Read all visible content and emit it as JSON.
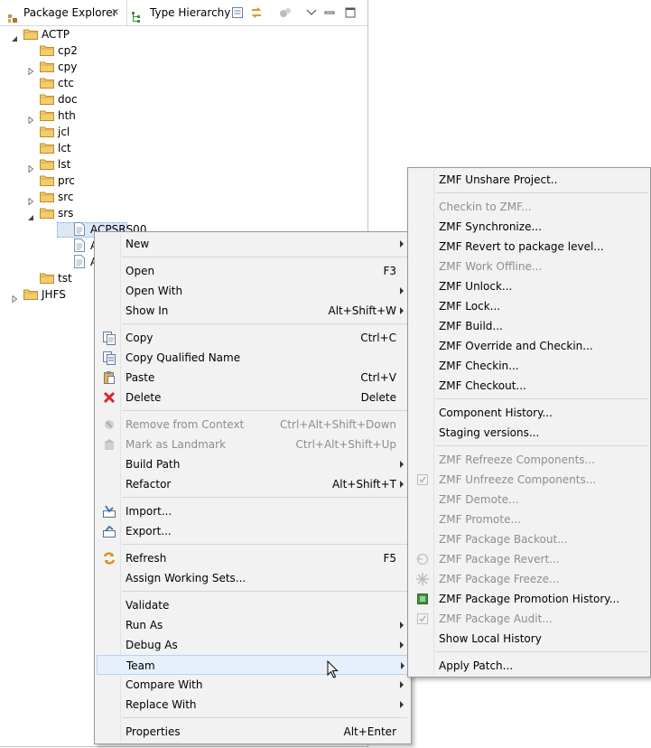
{
  "view": {
    "tabs": [
      {
        "label": "Package Explorer",
        "icon": "package-icon"
      },
      {
        "label": "Type Hierarchy",
        "icon": "hierarchy-icon"
      }
    ],
    "close_glyph": "✕"
  },
  "tree": {
    "nodes": [
      {
        "label": "ACTP",
        "icon": "folder-icon",
        "state": "open"
      },
      {
        "label": "cp2",
        "icon": "folder-icon",
        "state": "leaf"
      },
      {
        "label": "cpy",
        "icon": "folder-icon",
        "state": "closed"
      },
      {
        "label": "ctc",
        "icon": "folder-icon",
        "state": "leaf"
      },
      {
        "label": "doc",
        "icon": "folder-icon",
        "state": "leaf"
      },
      {
        "label": "hth",
        "icon": "folder-icon",
        "state": "closed"
      },
      {
        "label": "jcl",
        "icon": "folder-icon",
        "state": "leaf"
      },
      {
        "label": "lct",
        "icon": "folder-icon",
        "state": "leaf"
      },
      {
        "label": "lst",
        "icon": "folder-icon",
        "state": "closed"
      },
      {
        "label": "prc",
        "icon": "folder-icon",
        "state": "leaf"
      },
      {
        "label": "src",
        "icon": "folder-icon",
        "state": "closed"
      },
      {
        "label": "srs",
        "icon": "folder-icon",
        "state": "open"
      },
      {
        "label": "ACPSRS00",
        "icon": "file-icon",
        "state": "leaf"
      },
      {
        "label": "ACI",
        "icon": "file-icon",
        "state": "leaf"
      },
      {
        "label": "ACI",
        "icon": "file-icon",
        "state": "leaf"
      },
      {
        "label": "tst",
        "icon": "folder-icon",
        "state": "leaf"
      },
      {
        "label": "JHFS",
        "icon": "folder-icon",
        "state": "closed"
      }
    ]
  },
  "context_menu": {
    "items": [
      {
        "label": "New",
        "shortcut": "",
        "submenu": true,
        "enabled": true,
        "icon": ""
      },
      {
        "sep": true
      },
      {
        "label": "Open",
        "shortcut": "F3",
        "submenu": false,
        "enabled": true,
        "icon": ""
      },
      {
        "label": "Open With",
        "shortcut": "",
        "submenu": true,
        "enabled": true,
        "icon": ""
      },
      {
        "label": "Show In",
        "shortcut": "Alt+Shift+W",
        "submenu": true,
        "enabled": true,
        "icon": ""
      },
      {
        "sep": true
      },
      {
        "label": "Copy",
        "shortcut": "Ctrl+C",
        "submenu": false,
        "enabled": true,
        "icon": "copy-icon"
      },
      {
        "label": "Copy Qualified Name",
        "shortcut": "",
        "submenu": false,
        "enabled": true,
        "icon": "copy-qualified-icon"
      },
      {
        "label": "Paste",
        "shortcut": "Ctrl+V",
        "submenu": false,
        "enabled": true,
        "icon": "paste-icon"
      },
      {
        "label": "Delete",
        "shortcut": "Delete",
        "submenu": false,
        "enabled": true,
        "icon": "delete-icon"
      },
      {
        "sep": true
      },
      {
        "label": "Remove from Context",
        "shortcut": "Ctrl+Alt+Shift+Down",
        "submenu": false,
        "enabled": false,
        "icon": "remove-context-icon"
      },
      {
        "label": "Mark as Landmark",
        "shortcut": "Ctrl+Alt+Shift+Up",
        "submenu": false,
        "enabled": false,
        "icon": "landmark-icon"
      },
      {
        "label": "Build Path",
        "shortcut": "",
        "submenu": true,
        "enabled": true,
        "icon": ""
      },
      {
        "label": "Refactor",
        "shortcut": "Alt+Shift+T",
        "submenu": true,
        "enabled": true,
        "icon": ""
      },
      {
        "sep": true
      },
      {
        "label": "Import...",
        "shortcut": "",
        "submenu": false,
        "enabled": true,
        "icon": "import-icon"
      },
      {
        "label": "Export...",
        "shortcut": "",
        "submenu": false,
        "enabled": true,
        "icon": "export-icon"
      },
      {
        "sep": true
      },
      {
        "label": "Refresh",
        "shortcut": "F5",
        "submenu": false,
        "enabled": true,
        "icon": "refresh-icon"
      },
      {
        "label": "Assign Working Sets...",
        "shortcut": "",
        "submenu": false,
        "enabled": true,
        "icon": ""
      },
      {
        "sep": true
      },
      {
        "label": "Validate",
        "shortcut": "",
        "submenu": false,
        "enabled": true,
        "icon": ""
      },
      {
        "label": "Run As",
        "shortcut": "",
        "submenu": true,
        "enabled": true,
        "icon": ""
      },
      {
        "label": "Debug As",
        "shortcut": "",
        "submenu": true,
        "enabled": true,
        "icon": ""
      },
      {
        "label": "Team",
        "shortcut": "",
        "submenu": true,
        "enabled": true,
        "icon": "",
        "highlighted": true
      },
      {
        "label": "Compare With",
        "shortcut": "",
        "submenu": true,
        "enabled": true,
        "icon": ""
      },
      {
        "label": "Replace With",
        "shortcut": "",
        "submenu": true,
        "enabled": true,
        "icon": ""
      },
      {
        "sep": true
      },
      {
        "label": "Properties",
        "shortcut": "Alt+Enter",
        "submenu": false,
        "enabled": true,
        "icon": ""
      }
    ]
  },
  "team_menu": {
    "items": [
      {
        "label": "ZMF Unshare Project..",
        "enabled": true,
        "icon": ""
      },
      {
        "sep": true
      },
      {
        "label": "Checkin to ZMF...",
        "enabled": false,
        "icon": ""
      },
      {
        "label": "ZMF Synchronize...",
        "enabled": true,
        "icon": ""
      },
      {
        "label": "ZMF Revert to package level...",
        "enabled": true,
        "icon": ""
      },
      {
        "label": "ZMF Work Offline...",
        "enabled": false,
        "icon": ""
      },
      {
        "label": "ZMF Unlock...",
        "enabled": true,
        "icon": ""
      },
      {
        "label": "ZMF Lock...",
        "enabled": true,
        "icon": ""
      },
      {
        "label": "ZMF Build...",
        "enabled": true,
        "icon": ""
      },
      {
        "label": "ZMF Override and Checkin...",
        "enabled": true,
        "icon": ""
      },
      {
        "label": "ZMF Checkin...",
        "enabled": true,
        "icon": ""
      },
      {
        "label": "ZMF Checkout...",
        "enabled": true,
        "icon": ""
      },
      {
        "sep": true
      },
      {
        "label": "Component History...",
        "enabled": true,
        "icon": ""
      },
      {
        "label": "Staging versions...",
        "enabled": true,
        "icon": ""
      },
      {
        "sep": true
      },
      {
        "label": "ZMF Refreeze Components...",
        "enabled": false,
        "icon": ""
      },
      {
        "label": "ZMF Unfreeze Components...",
        "enabled": false,
        "icon": "check-icon"
      },
      {
        "label": "ZMF Demote...",
        "enabled": false,
        "icon": ""
      },
      {
        "label": "ZMF Promote...",
        "enabled": false,
        "icon": ""
      },
      {
        "label": "ZMF Package Backout...",
        "enabled": false,
        "icon": ""
      },
      {
        "label": "ZMF Package Revert...",
        "enabled": false,
        "icon": "revert-icon"
      },
      {
        "label": "ZMF Package Freeze...",
        "enabled": false,
        "icon": "freeze-icon"
      },
      {
        "label": "ZMF Package Promotion History...",
        "enabled": true,
        "icon": "promotion-history-icon"
      },
      {
        "label": "ZMF Package Audit...",
        "enabled": false,
        "icon": "check-icon"
      },
      {
        "label": "Show Local History",
        "enabled": true,
        "icon": ""
      },
      {
        "sep": true
      },
      {
        "label": "Apply Patch...",
        "enabled": true,
        "icon": ""
      }
    ]
  },
  "colors": {
    "selection": "#dbe8f6",
    "menu_bg": "#f2f2f2",
    "highlight": "#e5f0fb",
    "folder": "#e8b84a",
    "disabled_text": "#8d8d8d"
  }
}
